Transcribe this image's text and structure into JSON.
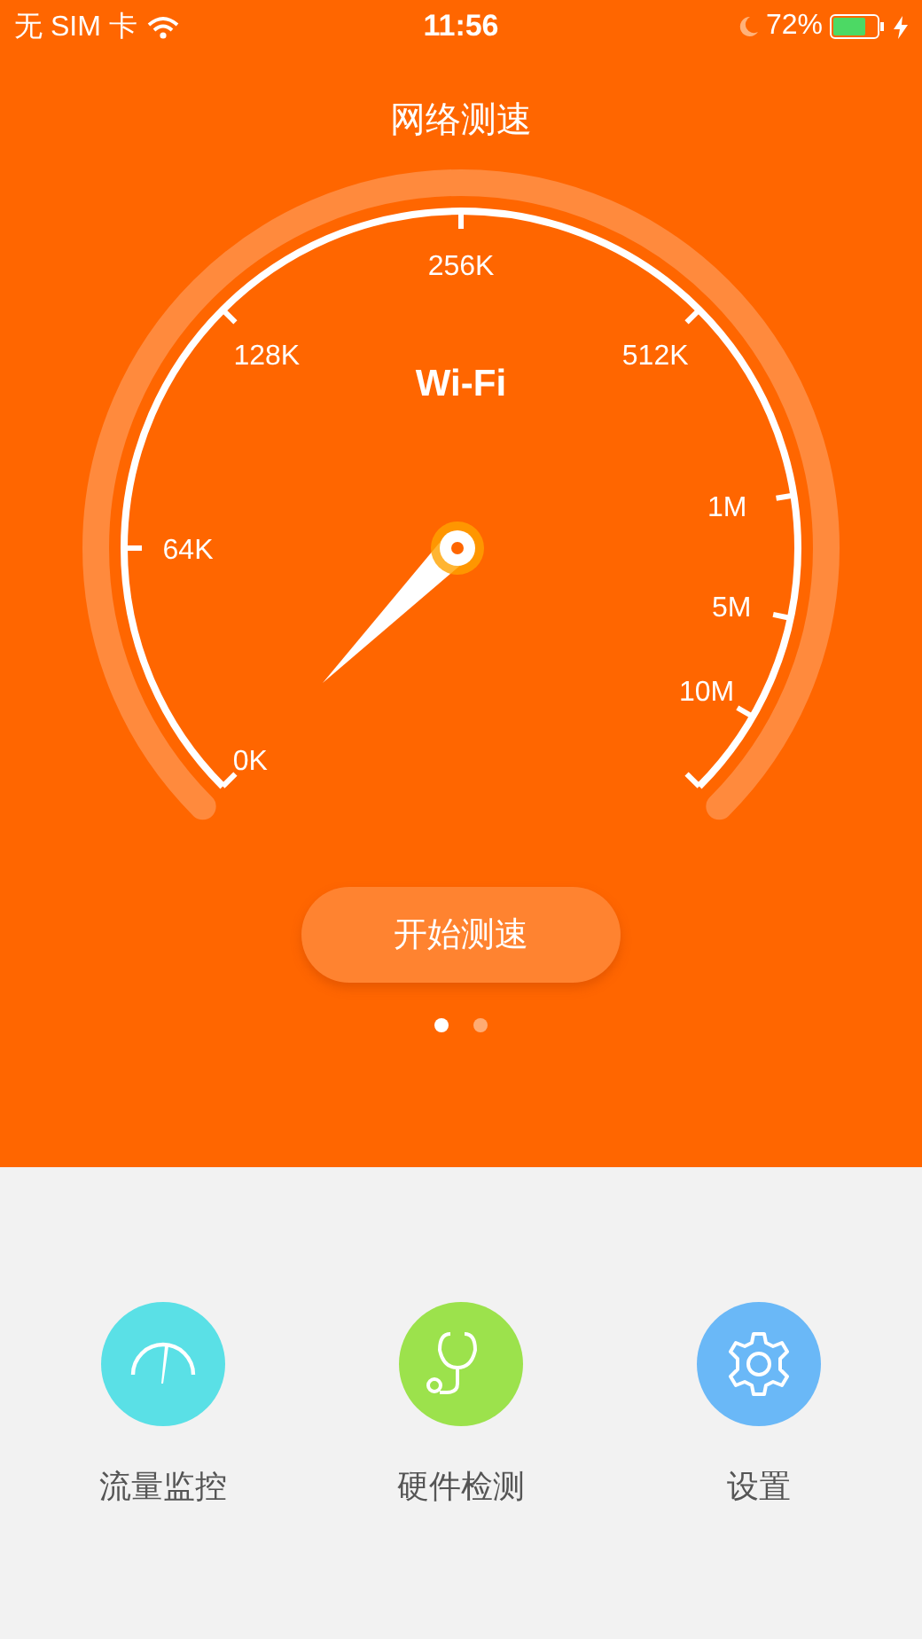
{
  "status_bar": {
    "carrier": "无 SIM 卡",
    "time": "11:56",
    "battery": "72%"
  },
  "title": "网络测速",
  "gauge": {
    "mode": "Wi-Fi",
    "scale": [
      "0K",
      "64K",
      "128K",
      "256K",
      "512K",
      "1M",
      "5M",
      "10M"
    ]
  },
  "start_button": "开始测速",
  "pages": [
    {
      "selected": true
    },
    {
      "selected": false
    }
  ],
  "tools": [
    {
      "kind": "traffic",
      "label": "流量监控",
      "color": "#5ae0e6"
    },
    {
      "kind": "hardware",
      "label": "硬件检测",
      "color": "#9ce24c"
    },
    {
      "kind": "settings",
      "label": "设置",
      "color": "#6ab8f7"
    }
  ]
}
